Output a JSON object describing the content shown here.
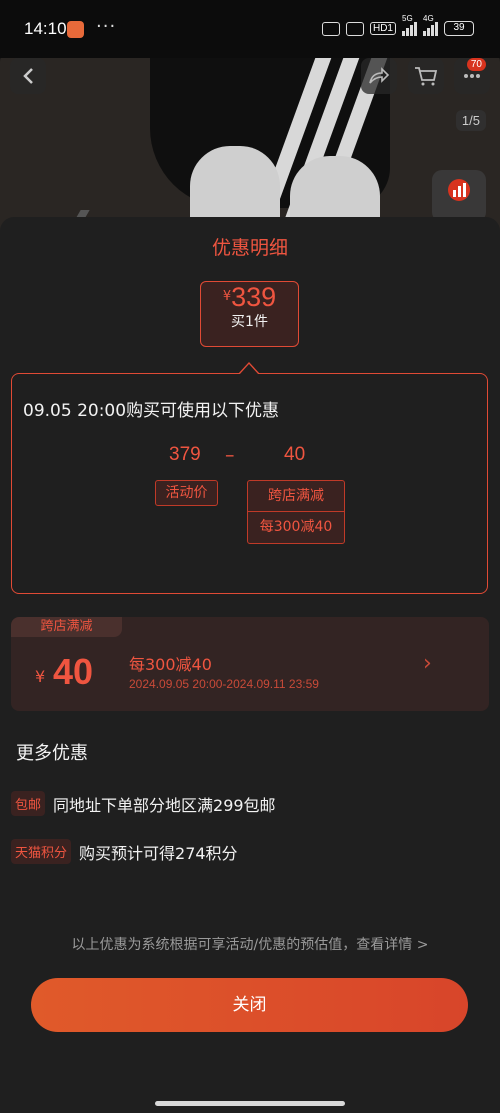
{
  "status_bar": {
    "time": "14:10",
    "dots": "···",
    "network": "HD1",
    "gen1": "5G",
    "gen2": "4G",
    "battery": "39"
  },
  "product_view": {
    "cart_badge": "70",
    "page_indicator": "1/5"
  },
  "sheet": {
    "title": "优惠明细",
    "price": {
      "currency": "¥",
      "amount": "339",
      "quantity": "买1件"
    },
    "detail": {
      "heading": "09.05 20:00购买可使用以下优惠",
      "base_value": "379",
      "operator": "–",
      "discount_value": "40",
      "base_label": "活动价",
      "discount_label_1": "跨店满减",
      "discount_label_2": "每300减40"
    },
    "coupon": {
      "tag": "跨店满减",
      "currency": "¥",
      "amount": "40",
      "rule": "每300减40",
      "validity": "2024.09.05 20:00-2024.09.11 23:59",
      "chevron": "›"
    },
    "more": {
      "title": "更多优惠",
      "items": [
        {
          "tag": "包邮",
          "text": "同地址下单部分地区满299包邮"
        },
        {
          "tag": "天猫积分",
          "text": "购买预计可得274积分"
        }
      ]
    },
    "footnote": "以上优惠为系统根据可享活动/优惠的预估值，查看详情 >",
    "close_label": "关闭"
  },
  "colors": {
    "accent": "#ef5540",
    "sheet_bg": "#1f1f1f",
    "button_bg": "#e05a2a"
  }
}
